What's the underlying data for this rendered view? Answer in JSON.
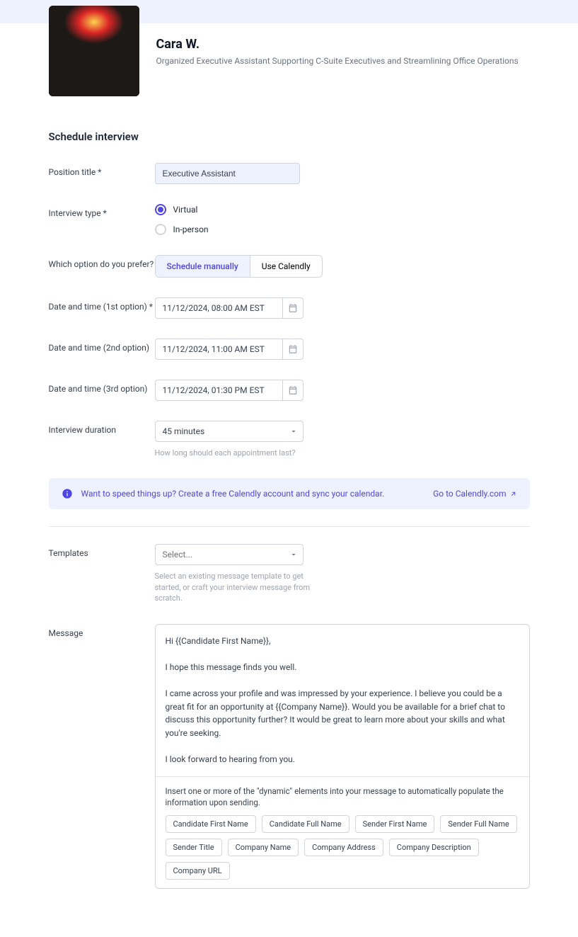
{
  "profile": {
    "name": "Cara W.",
    "tagline": "Organized Executive Assistant Supporting C-Suite Executives and Streamlining Office Operations"
  },
  "heading": "Schedule interview",
  "form": {
    "position_label": "Position title *",
    "position_value": "Executive Assistant",
    "interview_type_label": "Interview type *",
    "interview_type_options": {
      "virtual": "Virtual",
      "in_person": "In-person"
    },
    "scheduling_pref_label": "Which option do you prefer?",
    "scheduling_options": {
      "manual": "Schedule manually",
      "calendly": "Use Calendly"
    },
    "datetime1_label": "Date and time (1st option) *",
    "datetime1_value": "11/12/2024, 08:00 AM EST",
    "datetime2_label": "Date and time (2nd option)",
    "datetime2_value": "11/12/2024, 11:00 AM EST",
    "datetime3_label": "Date and time (3rd option)",
    "datetime3_value": "11/12/2024, 01:30 PM EST",
    "duration_label": "Interview duration",
    "duration_value": "45 minutes",
    "duration_help": "How long should each appointment last?"
  },
  "callout": {
    "text": "Want to speed things up? Create a free Calendly account and sync your calendar.",
    "link_label": "Go to Calendly.com"
  },
  "templates": {
    "label": "Templates",
    "placeholder": "Select...",
    "help": "Select an existing message template to get started, or craft your interview message from scratch."
  },
  "message": {
    "label": "Message",
    "body": "Hi {{Candidate First Name}},\n\nI hope this message finds you well.\n\nI came across your profile and was impressed by your experience. I believe you could be a great fit for an opportunity at {{Company Name}}. Would you be available for a brief chat to discuss this opportunity further? It would be great to learn more about your skills and what you're seeking.\n\nI look forward to hearing from you.",
    "insert_help": "Insert one or more of the \"dynamic\" elements into your message to automatically populate the information upon sending.",
    "tags": [
      "Candidate First Name",
      "Candidate Full Name",
      "Sender First Name",
      "Sender Full Name",
      "Sender Title",
      "Company Name",
      "Company Address",
      "Company Description",
      "Company URL"
    ]
  }
}
